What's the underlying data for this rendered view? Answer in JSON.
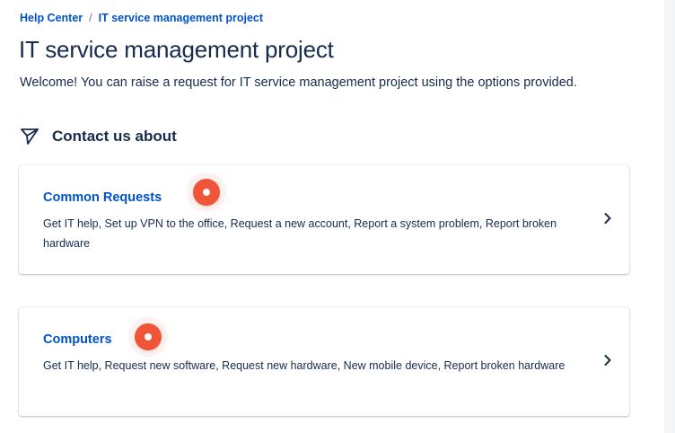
{
  "breadcrumb": {
    "home_label": "Help Center",
    "separator": "/",
    "project_label": "IT service management project"
  },
  "page": {
    "title": "IT service management project",
    "welcome": "Welcome! You can raise a request for IT service management project using the options provided."
  },
  "contact": {
    "heading": "Contact us about",
    "icon": "send-icon"
  },
  "cards": [
    {
      "title": "Common Requests",
      "description": "Get IT help, Set up VPN to the office, Request a new account, Report a system problem, Report broken hardware"
    },
    {
      "title": "Computers",
      "description": "Get IT help, Request new software, Request new hardware, New mobile device, Report broken hardware"
    }
  ],
  "colors": {
    "link": "#0052cc",
    "text": "#172b4d",
    "marker": "#f0553a"
  }
}
